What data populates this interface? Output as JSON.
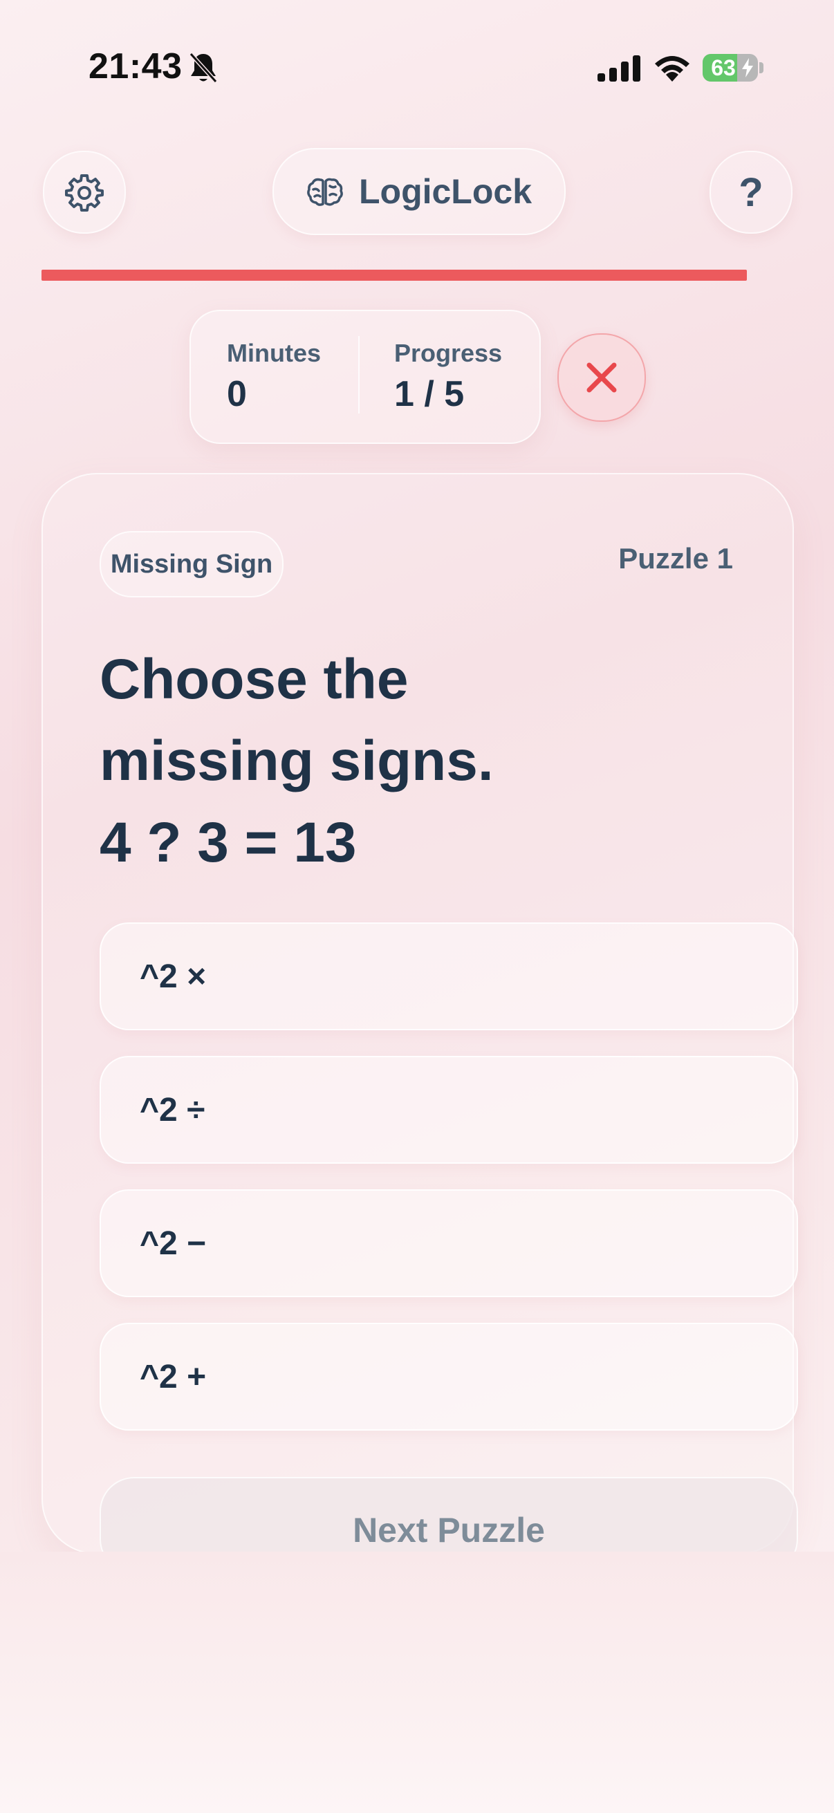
{
  "status_bar": {
    "time": "21:43",
    "battery_percent": 63,
    "battery_label": "63",
    "icons": [
      "bell-slash-icon",
      "cellular-signal-icon",
      "wifi-icon",
      "battery-charging-icon"
    ]
  },
  "header": {
    "settings_icon": "gear-icon",
    "app_icon": "brain-icon",
    "app_title": "LogicLock",
    "help_label": "?"
  },
  "timer": {
    "remaining_fraction": 1.0,
    "color": "#ec5a5d"
  },
  "stats": {
    "minutes_label": "Minutes",
    "minutes_value": "0",
    "progress_label": "Progress",
    "progress_value": "1 / 5",
    "close_icon": "close-icon"
  },
  "puzzle": {
    "type": "Missing Sign",
    "number_label": "Puzzle 1",
    "question_lines": [
      "Choose the",
      "missing signs.",
      "4 ? 3 = 13"
    ],
    "options": [
      {
        "label": "^2 ×"
      },
      {
        "label": "^2 ÷"
      },
      {
        "label": "^2 −"
      },
      {
        "label": "^2 +"
      }
    ],
    "next_label": "Next Puzzle"
  },
  "colors": {
    "accent_red": "#ec5a5d",
    "text_dark": "#1f3247",
    "text_muted": "#3e536a",
    "battery_green": "#63c76a"
  }
}
